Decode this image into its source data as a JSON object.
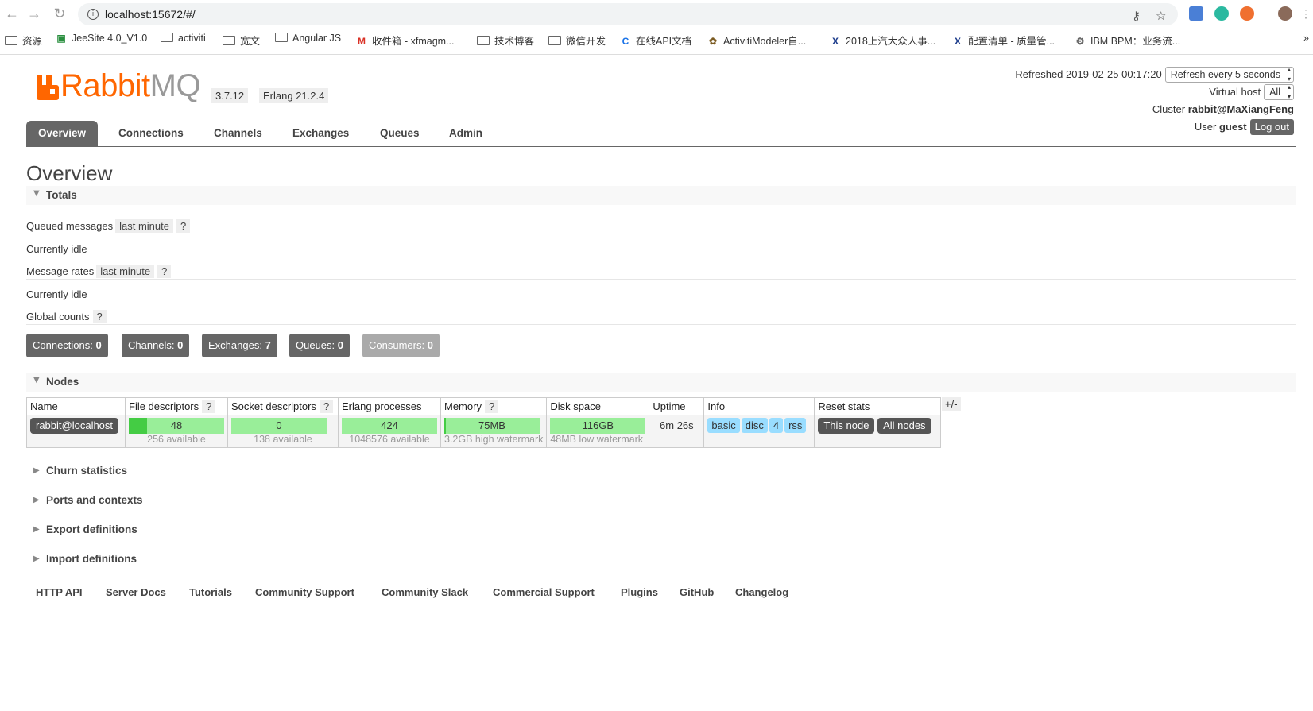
{
  "browser": {
    "url": "localhost:15672/#/",
    "bookmarks": [
      "资源",
      "JeeSite 4.0_V1.0",
      "activiti",
      "宽文",
      "Angular JS",
      "收件箱 - xfmagm...",
      "技术博客",
      "微信开发",
      "在线API文档",
      "ActivitiModeler自...",
      "2018上汽大众人事...",
      "配置清单 - 质量管...",
      "IBM BPM：业务流..."
    ],
    "more": "»"
  },
  "header": {
    "logo_primary": "Rabbit",
    "logo_secondary": "MQ",
    "version": "3.7.12",
    "erlang": "Erlang 21.2.4",
    "refreshed_label": "Refreshed 2019-02-25 00:17:20",
    "refresh_select": "Refresh every 5 seconds",
    "vhost_label": "Virtual host",
    "vhost_value": "All",
    "cluster_label": "Cluster",
    "cluster_value": "rabbit@MaXiangFeng",
    "user_label": "User",
    "user_value": "guest",
    "logout": "Log out"
  },
  "tabs": [
    "Overview",
    "Connections",
    "Channels",
    "Exchanges",
    "Queues",
    "Admin"
  ],
  "page_title": "Overview",
  "totals": {
    "title": "Totals",
    "queued_label": "Queued messages",
    "queued_chip": "last minute",
    "help": "?",
    "queued_status": "Currently idle",
    "rates_label": "Message rates",
    "rates_chip": "last minute",
    "rates_status": "Currently idle",
    "global_label": "Global counts",
    "counts": [
      {
        "label": "Connections:",
        "value": "0"
      },
      {
        "label": "Channels:",
        "value": "0"
      },
      {
        "label": "Exchanges:",
        "value": "7"
      },
      {
        "label": "Queues:",
        "value": "0"
      },
      {
        "label": "Consumers:",
        "value": "0"
      }
    ]
  },
  "nodes": {
    "title": "Nodes",
    "headers": [
      "Name",
      "File descriptors",
      "Socket descriptors",
      "Erlang processes",
      "Memory",
      "Disk space",
      "Uptime",
      "Info",
      "Reset stats"
    ],
    "help": "?",
    "plus_minus": "+/-",
    "row": {
      "name": "rabbit@localhost",
      "fd_value": "48",
      "fd_sub": "256 available",
      "fd_fraction": 0.19,
      "sd_value": "0",
      "sd_sub": "138 available",
      "sd_fraction": 0.0,
      "ep_value": "424",
      "ep_sub": "1048576 available",
      "ep_fraction": 0.0,
      "mem_value": "75MB",
      "mem_sub": "3.2GB high watermark",
      "mem_fraction": 0.02,
      "disk_value": "116GB",
      "disk_sub": "48MB low watermark",
      "disk_fraction": 0.0,
      "uptime": "6m 26s",
      "info_tags": [
        "basic",
        "disc",
        "4",
        "rss"
      ],
      "reset_this": "This node",
      "reset_all": "All nodes"
    }
  },
  "collapsed_sections": [
    "Churn statistics",
    "Ports and contexts",
    "Export definitions",
    "Import definitions"
  ],
  "footer_links": [
    "HTTP API",
    "Server Docs",
    "Tutorials",
    "Community Support",
    "Community Slack",
    "Commercial Support",
    "Plugins",
    "GitHub",
    "Changelog"
  ],
  "colors": {
    "brand": "#ff6600",
    "tab_active": "#666666",
    "bar_ok": "#99ee99",
    "tag": "#99ddff"
  }
}
